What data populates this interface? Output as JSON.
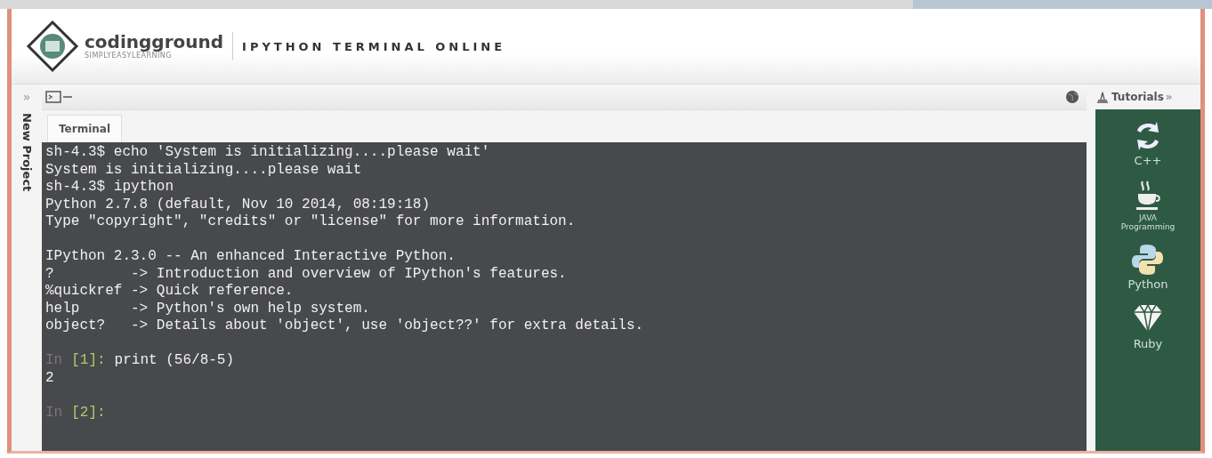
{
  "header": {
    "brand": "codingground",
    "tagline": "SIMPLYEASYLEARNING",
    "title": "IPYTHON TERMINAL ONLINE"
  },
  "sidebar": {
    "toggle": "»",
    "label": "New Project"
  },
  "tabs": [
    {
      "label": "Terminal",
      "selected": true
    }
  ],
  "terminal": {
    "lines": [
      {
        "kind": "text",
        "text": "sh-4.3$ echo 'System is initializing....please wait'"
      },
      {
        "kind": "text",
        "text": "System is initializing....please wait"
      },
      {
        "kind": "text",
        "text": "sh-4.3$ ipython"
      },
      {
        "kind": "text",
        "text": "Python 2.7.8 (default, Nov 10 2014, 08:19:18)"
      },
      {
        "kind": "text",
        "text": "Type \"copyright\", \"credits\" or \"license\" for more information."
      },
      {
        "kind": "blank"
      },
      {
        "kind": "text",
        "text": "IPython 2.3.0 -- An enhanced Interactive Python."
      },
      {
        "kind": "text",
        "text": "?         -> Introduction and overview of IPython's features."
      },
      {
        "kind": "text",
        "text": "%quickref -> Quick reference."
      },
      {
        "kind": "text",
        "text": "help      -> Python's own help system."
      },
      {
        "kind": "text",
        "text": "object?   -> Details about 'object', use 'object??' for extra details."
      },
      {
        "kind": "blank"
      },
      {
        "kind": "prompt",
        "prompt": "In",
        "number": "[1]:",
        "code": "print (56/8-5)"
      },
      {
        "kind": "text",
        "text": "2"
      },
      {
        "kind": "blank"
      },
      {
        "kind": "prompt",
        "prompt": "In",
        "number": "[2]:"
      }
    ]
  },
  "tutorials": {
    "title": "Tutorials",
    "toggle": "»",
    "items": [
      {
        "kind": "cpp",
        "lines": [
          "C++"
        ]
      },
      {
        "kind": "java",
        "lines": [
          "JAVA",
          "Programming"
        ]
      },
      {
        "kind": "python",
        "lines": [
          "Python"
        ]
      },
      {
        "kind": "ruby",
        "lines": [
          "Ruby"
        ]
      }
    ]
  }
}
